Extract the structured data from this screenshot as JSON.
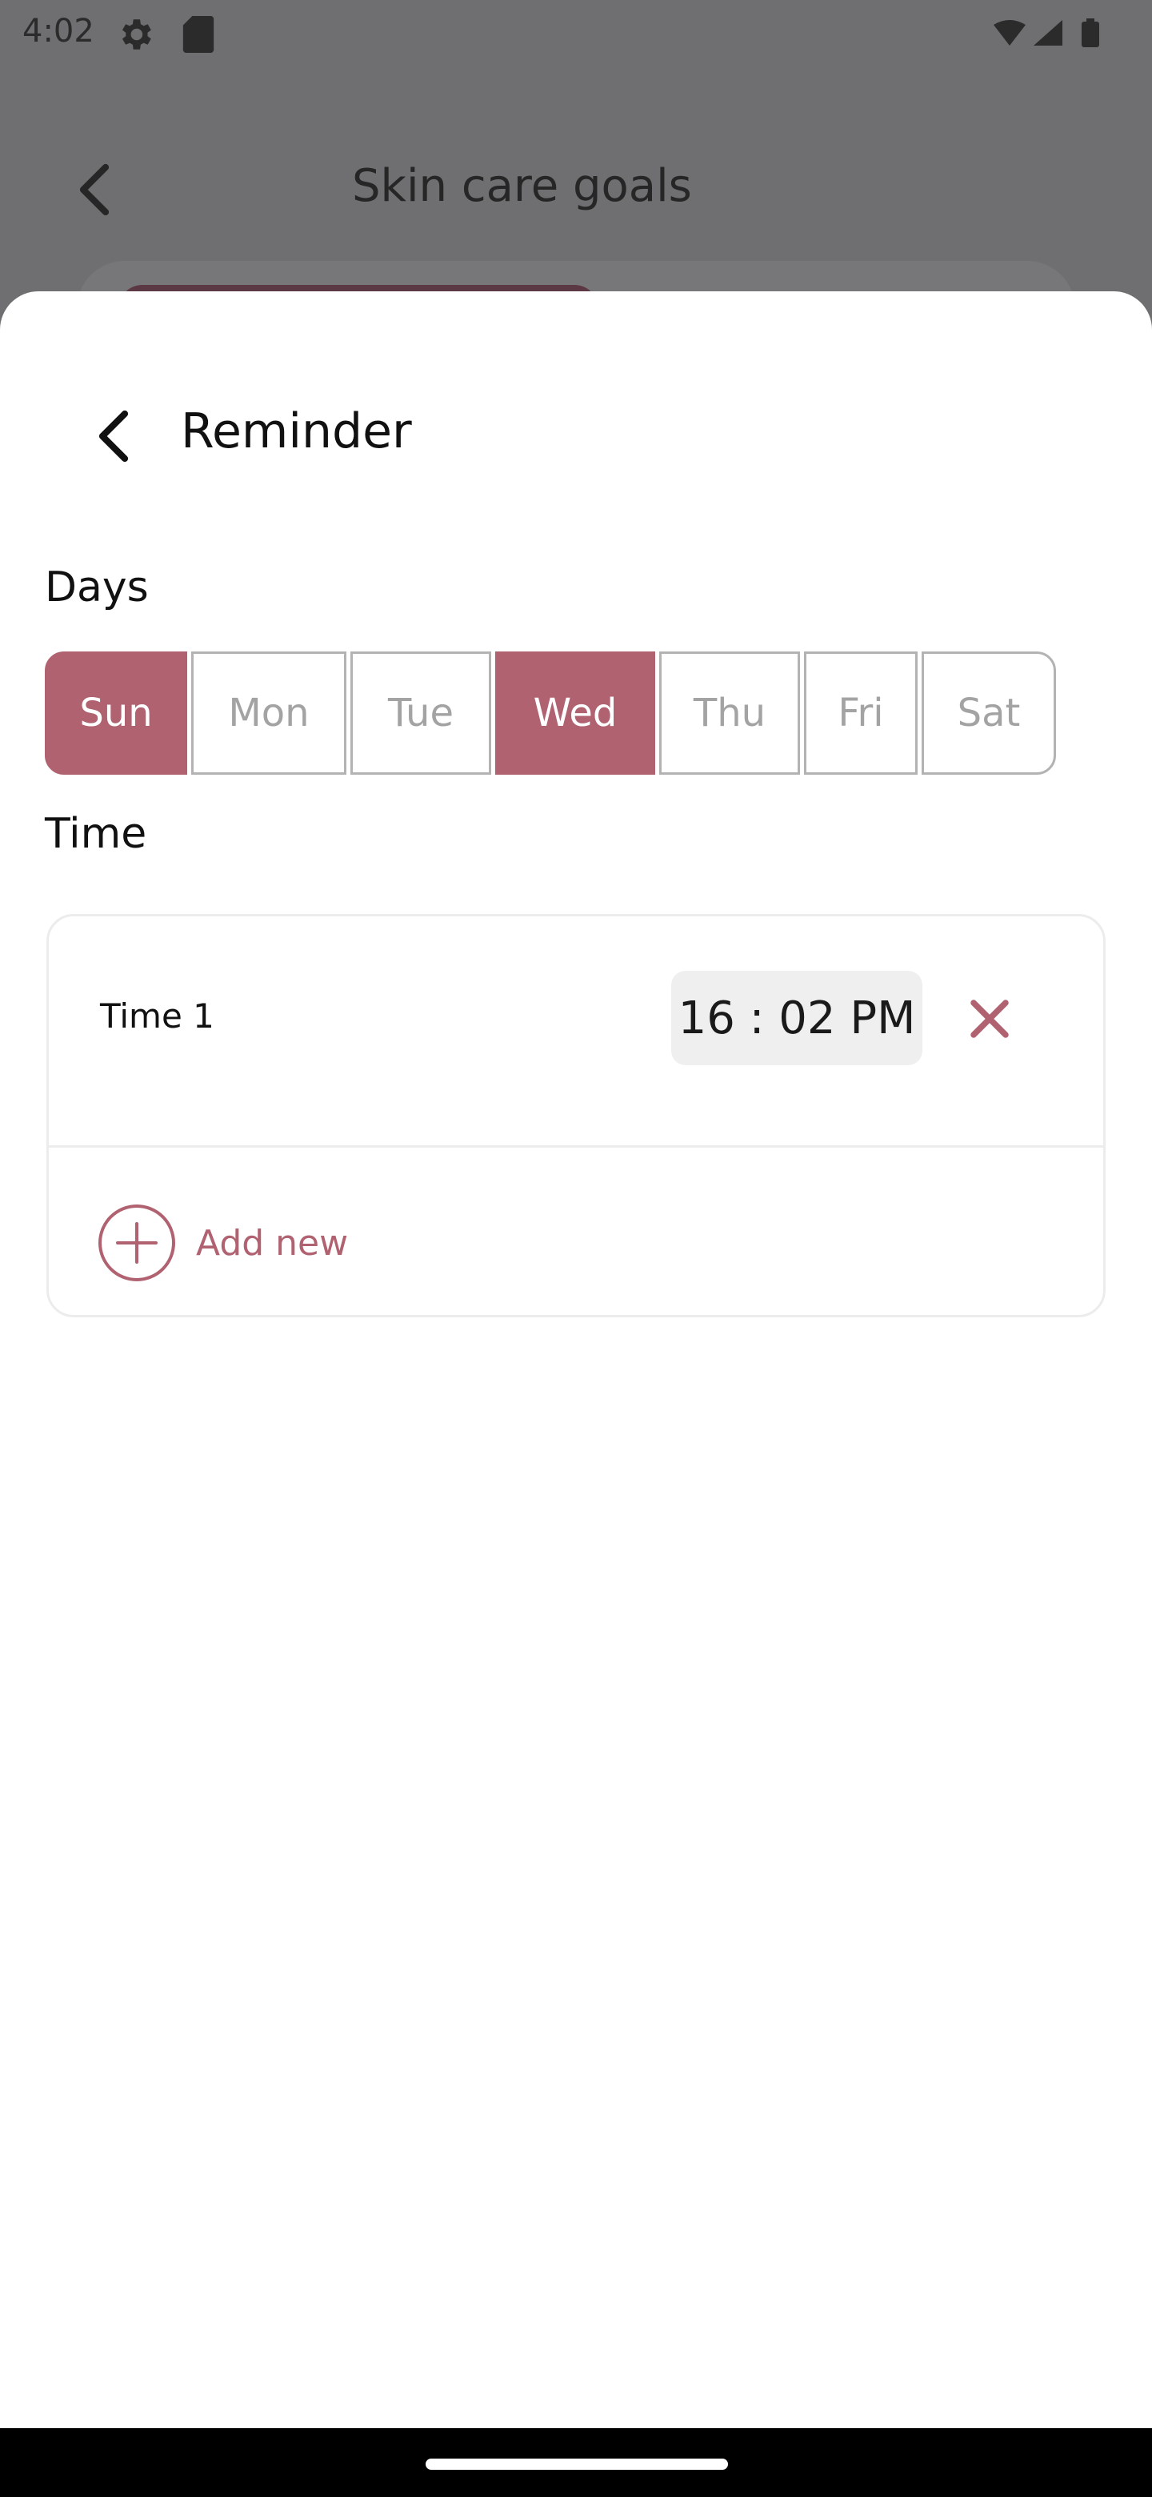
{
  "status_bar": {
    "time": "4:02"
  },
  "background": {
    "title": "Skin care goals"
  },
  "sheet": {
    "title": "Reminder",
    "days_label": "Days",
    "days": [
      {
        "label": "Sun",
        "selected": true
      },
      {
        "label": "Mon",
        "selected": false
      },
      {
        "label": "Tue",
        "selected": false
      },
      {
        "label": "Wed",
        "selected": true
      },
      {
        "label": "Thu",
        "selected": false
      },
      {
        "label": "Fri",
        "selected": false
      },
      {
        "label": "Sat",
        "selected": false
      }
    ],
    "time_label": "Time",
    "times": [
      {
        "label": "Time 1",
        "value": "16 : 02 PM"
      }
    ],
    "add_new_label": "Add new"
  },
  "colors": {
    "accent": "#b16271",
    "scrim": "#6f6e70"
  }
}
